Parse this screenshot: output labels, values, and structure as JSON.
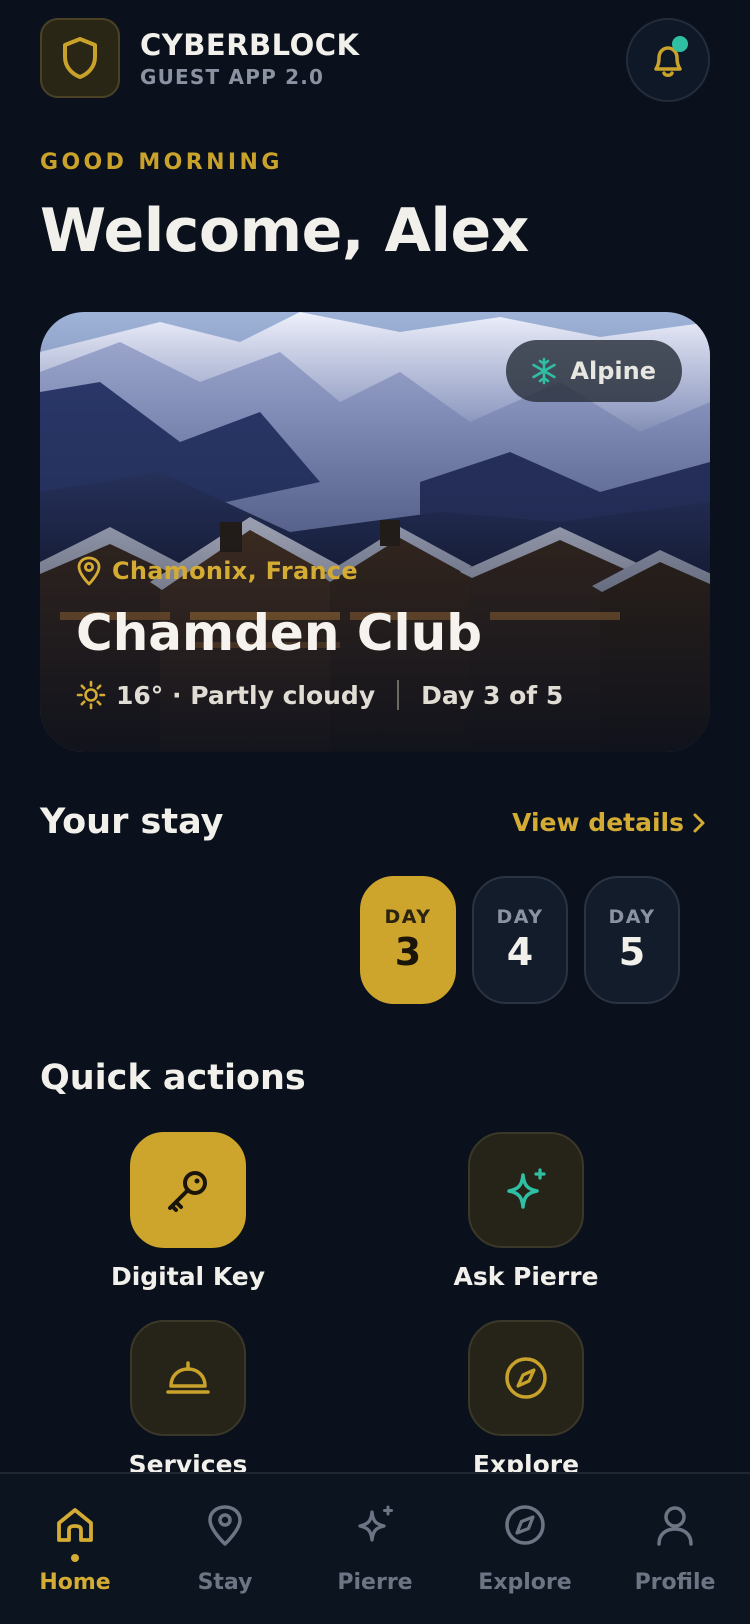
{
  "header": {
    "brand_name": "CYBERBLOCK",
    "brand_sub": "GUEST APP 2.0",
    "logo_icon": "shield-icon",
    "notification_icon": "bell-icon"
  },
  "greeting": "GOOD MORNING",
  "welcome": "Welcome, Alex",
  "hero": {
    "tag": "Alpine",
    "tag_icon": "snowflake-icon",
    "location": "Chamonix, France",
    "title": "Chamden Club",
    "weather": "16° · Partly cloudy",
    "weather_icon": "sun-icon",
    "day_progress": "Day 3 of 5"
  },
  "stay": {
    "title": "Your stay",
    "view_details": "View details",
    "days": [
      {
        "label": "DAY",
        "number": "3",
        "active": true
      },
      {
        "label": "DAY",
        "number": "4",
        "active": false
      },
      {
        "label": "DAY",
        "number": "5",
        "active": false
      }
    ]
  },
  "quick_actions": {
    "title": "Quick actions",
    "items": [
      {
        "label": "Digital Key",
        "icon": "key-icon"
      },
      {
        "label": "Ask Pierre",
        "icon": "sparkle-icon"
      },
      {
        "label": "Services",
        "icon": "concierge-bell-icon"
      },
      {
        "label": "Explore",
        "icon": "compass-icon"
      }
    ]
  },
  "nav": {
    "items": [
      {
        "label": "Home",
        "icon": "home-icon",
        "active": true
      },
      {
        "label": "Stay",
        "icon": "map-pin-icon",
        "active": false
      },
      {
        "label": "Pierre",
        "icon": "sparkle-icon",
        "active": false
      },
      {
        "label": "Explore",
        "icon": "compass-icon",
        "active": false
      },
      {
        "label": "Profile",
        "icon": "user-icon",
        "active": false
      }
    ]
  },
  "colors": {
    "background": "#0a111c",
    "accent": "#cda42c",
    "teal": "#2fc0a4",
    "muted": "#6d7584"
  }
}
